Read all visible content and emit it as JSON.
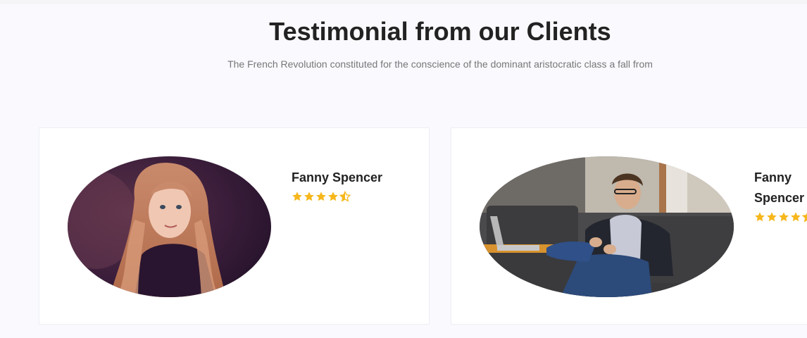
{
  "section": {
    "title": "Testimonial from our Clients",
    "subtitle": "The French Revolution constituted for the conscience of the dominant aristocratic class a fall from"
  },
  "testimonials": [
    {
      "name": "Fanny Spencer",
      "rating": 4.5,
      "photo_icon": "girl-portrait-photo"
    },
    {
      "name": "Fanny Spencer",
      "rating": 4.5,
      "photo_icon": "man-with-laptop-photo"
    }
  ],
  "colors": {
    "background": "#f9f9fe",
    "star": "#f6b71c",
    "heading": "#222222",
    "subtitle": "#777777"
  }
}
